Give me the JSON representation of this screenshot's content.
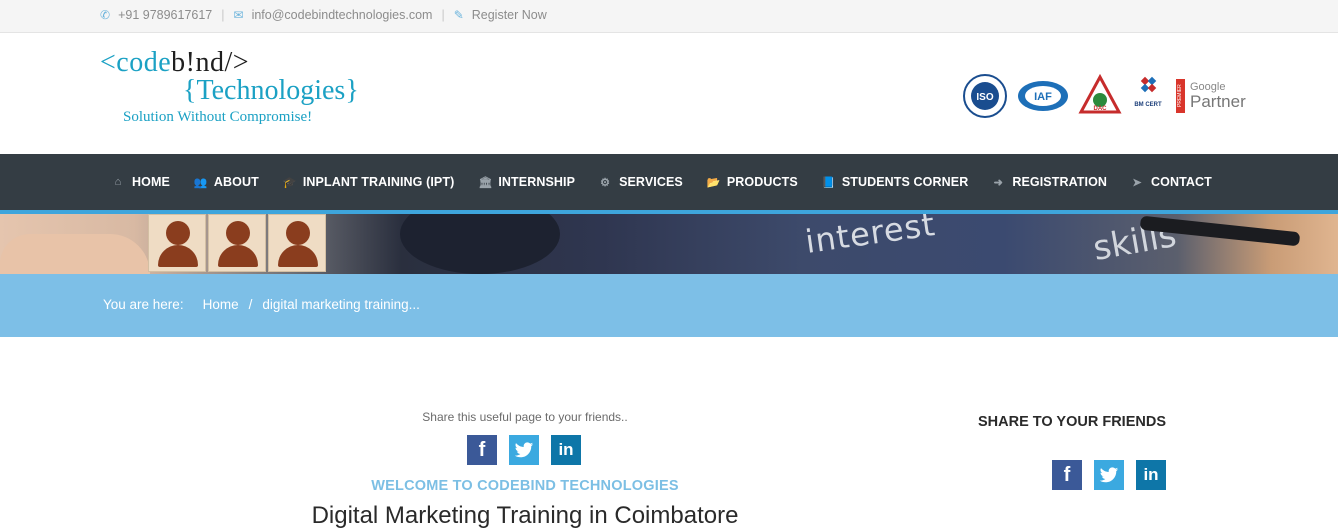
{
  "topbar": {
    "phone": "+91 9789617617",
    "email": "info@codebindtechnologies.com",
    "register": "Register Now",
    "phone_icon": "phone-icon",
    "email_icon": "envelope-icon",
    "register_icon": "edit-icon"
  },
  "logo": {
    "line1_prefix": "<code",
    "line1_suffix": "b!nd/>",
    "line2": "{Technologies}",
    "tagline": "Solution Without Compromise!"
  },
  "certs": {
    "iso": "ISO",
    "iaf": "IAF",
    "dac": "DAC",
    "bmcert": "BM CERT",
    "google_small": "Google",
    "google_partner": "Partner",
    "premier": "PREMIER"
  },
  "nav": {
    "items": [
      {
        "label": "HOME",
        "icon": "home-icon",
        "glyph": "⌂"
      },
      {
        "label": "ABOUT",
        "icon": "users-icon",
        "glyph": "👥"
      },
      {
        "label": "INPLANT TRAINING (IPT)",
        "icon": "graduation-cap-icon",
        "glyph": "🎓"
      },
      {
        "label": "INTERNSHIP",
        "icon": "institution-icon",
        "glyph": "🏛"
      },
      {
        "label": "SERVICES",
        "icon": "cogs-icon",
        "glyph": "⚙"
      },
      {
        "label": "PRODUCTS",
        "icon": "folder-open-icon",
        "glyph": "📂"
      },
      {
        "label": "STUDENTS CORNER",
        "icon": "book-icon",
        "glyph": "📘"
      },
      {
        "label": "REGISTRATION",
        "icon": "sign-in-icon",
        "glyph": "➜"
      },
      {
        "label": "CONTACT",
        "icon": "location-arrow-icon",
        "glyph": "➤"
      }
    ],
    "accent": "#3ea5dc",
    "background": "#343d44"
  },
  "banner": {
    "word1": "interest",
    "word2": "skills"
  },
  "breadcrumb": {
    "label": "You are here:",
    "home": "Home",
    "separator": "/",
    "current": "digital marketing training..."
  },
  "content": {
    "share_note": "Share this useful page to your friends..",
    "welcome": "WELCOME TO CODEBIND TECHNOLOGIES",
    "title": "Digital Marketing Training in Coimbatore"
  },
  "sidebar": {
    "share_title": "SHARE TO YOUR FRIENDS"
  },
  "social": {
    "facebook": "f",
    "twitter": "🐦",
    "linkedin": "in"
  }
}
